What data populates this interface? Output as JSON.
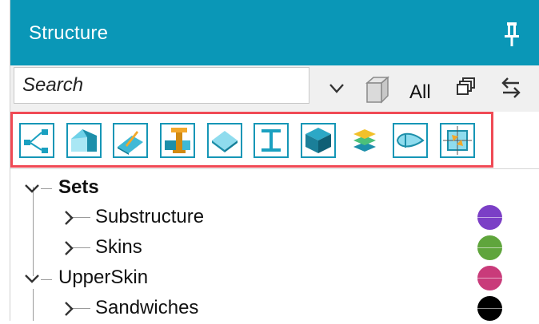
{
  "panel": {
    "title": "Structure"
  },
  "search": {
    "placeholder": "Search"
  },
  "toolbar": {
    "all_label": "All"
  },
  "filter_icons": [
    "connection-icon",
    "solid-body-icon",
    "stiffener-icon",
    "beam-joint-icon",
    "plate-icon",
    "i-beam-icon",
    "cube-icon",
    "layers-icon",
    "airfoil-icon",
    "fit-view-icon"
  ],
  "tree": {
    "items": [
      {
        "label": "Sets",
        "bold": true,
        "level": 0,
        "expanded": true,
        "color": null
      },
      {
        "label": "Substructure",
        "bold": false,
        "level": 1,
        "expanded": false,
        "color": "#7b3fc6"
      },
      {
        "label": "Skins",
        "bold": false,
        "level": 1,
        "expanded": false,
        "color": "#5fa53c"
      },
      {
        "label": "UpperSkin",
        "bold": false,
        "level": 0,
        "expanded": true,
        "color": "#c93b7a"
      },
      {
        "label": "Sandwiches",
        "bold": false,
        "level": 1,
        "expanded": false,
        "color": "#000000"
      }
    ]
  },
  "colors": {
    "titlebar": "#0a97b7",
    "accent": "#1596b6",
    "highlight_border": "#f04a55"
  }
}
